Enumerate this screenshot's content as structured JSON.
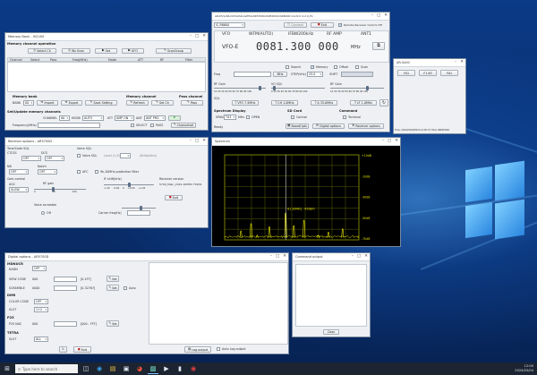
{
  "memory_bank": {
    "title": "Memory Bank - ISCU00",
    "ops_label": "Memory channel operation",
    "buttons": [
      "Select Ch",
      "Ws Scan",
      "Set",
      "UFO",
      "ScanGroup"
    ],
    "columns": [
      "Channel",
      "Select",
      "Pass",
      "Freq(MHz)",
      "Mode",
      "ATT",
      "RF",
      "Filter"
    ],
    "memory_bank_label": "Memory bank",
    "bank_label": "BANK",
    "bank_value": "00",
    "import_label": "Import",
    "export_label": "Export",
    "save_setting_label": "Save Setting",
    "memory_channel_label": "Memory channel",
    "refresh_label": "Refresh",
    "set_ch_label": "Set Ch",
    "pass_channel_label": "Pass channel",
    "pass_label": "Pass",
    "set_update_label": "Set/Update memory channels",
    "channel_label": "CHANNEL",
    "channel_value": "00",
    "mode_label": "MODE",
    "mode_value": "AUTO",
    "att_label": "ATT",
    "att_value": "AMP ON",
    "ant_label": "ANT",
    "ant_value": "ANT PRG",
    "freq_label": "Frequency(MHz)",
    "select_label": "SELECT",
    "pass_chk_label": "PASS",
    "channelset_label": "Channelset"
  },
  "main": {
    "title": "AR-DV1/AR-DV10/AR-ALPHA/AR5700D/AR5001D/AR6000 Control 4.2.0_Ex",
    "mode_badge": "IC-R8600",
    "connect_label": "Connect",
    "exit_label": "Exit",
    "remote_label": "Remote Receiver Control Off",
    "headers": [
      "VFO",
      "WFM(AUTO)",
      "IFBW200kHz",
      "RF AMP",
      "ANT1"
    ],
    "vfo_label": "VFO-E",
    "frequency": "0081.300 000",
    "unit": "MHz",
    "search_label": "Search",
    "memory_label": "Memory",
    "offset_label": "Offset",
    "scan_label": "Scan",
    "freq_label": "Freq",
    "freq_set_label": "MHz",
    "step_label": "STEP(kHz)",
    "step_value": "25.0",
    "shift_label": "SHIFT",
    "rf_gain_label": "RF Gain",
    "vo_sql_label": "VO SQL",
    "rf_gain_scale": "10 20 30 40 50 60 70 80 90 100",
    "rf_gain_scale2": "0 20 30 40 50 60 70 80 90 100",
    "sql_label": "SQL",
    "vfo_buttons": [
      "VFO 7.5MHz",
      "CH 1.0MHz",
      "A 33.0MHz",
      "LF 1.0MHz"
    ],
    "spectrum_display_label": "Spectrum Display",
    "span_label": "SPAN",
    "span_value": "TX3",
    "span_unit": "MHz",
    "open_label": "OPEN",
    "sd_card_label": "SD Card",
    "control_label": "Control",
    "command_label": "Command",
    "terminal_label": "Terminal",
    "ready_label": "Ready",
    "board_label": "BoardOpts",
    "digital_options_label": "Digital options",
    "receiver_options_label": "Receiver options"
  },
  "small_window": {
    "title": "AR-5x00",
    "buttons": [
      "F01",
      "F1 63",
      "F01"
    ],
    "status": "Time: 2024/03/04(ESYS-12:00:??) Total: R8600HAR"
  },
  "receiver_options": {
    "title": "Receiver options - AR5700D",
    "tone_label": "Tone/Code SQL",
    "ctcss_label": "CTCSS",
    "ctcss_value": "OFF",
    "dcs_label": "DCS",
    "dcs_value": "OFF",
    "voice_sql_label": "Voice SQL",
    "voice_sql_chk": "Voice SQL",
    "level_label": "Level (1-9)",
    "attrib_label": "Attrib(dbm)",
    "nb_label": "NB",
    "nb_value": "OFF",
    "notch_label": "Notch",
    "notch_value": "OFF",
    "afc_label": "AFC",
    "lsb_filter_label": "9k-10MHz protection filter",
    "gain_control_label": "Gain control",
    "agc_label": "AGC",
    "agc_value": "SLOW",
    "rf_gain_label": "RF gain",
    "rf_gain_scale": "0 60 100",
    "if_shift_label": "IF shift(kHz)",
    "if_shift_scale": "-1.20 -0.60 0 +0.60 +1.20",
    "receiver_version_label": "Receiver version",
    "receiver_version": "5700_Main_2019 16MHC F0634",
    "exit_label": "Exit",
    "voice_scramble_label": "Voice scramble",
    "vs_value": "Off",
    "carrier_label": "Carrier freq(Hz)"
  },
  "spectrum": {
    "title": "Spectrum",
    "marker_label": "81.30MHz, -45dBm",
    "y_labels": [
      "+10dB",
      "-10dB",
      "-30dB",
      "-50dB",
      "-70dB"
    ],
    "peaks": [
      {
        "freq_mhz": 80.2,
        "level_db": -62
      },
      {
        "freq_mhz": 80.45,
        "level_db": -55
      },
      {
        "freq_mhz": 80.6,
        "level_db": -66
      },
      {
        "freq_mhz": 80.9,
        "level_db": -58
      },
      {
        "freq_mhz": 81.3,
        "level_db": -45
      },
      {
        "freq_mhz": 81.5,
        "level_db": -57
      },
      {
        "freq_mhz": 81.75,
        "level_db": -52
      },
      {
        "freq_mhz": 82.1,
        "level_db": -66
      },
      {
        "freq_mhz": 82.35,
        "level_db": -63
      },
      {
        "freq_mhz": 82.7,
        "level_db": -60
      }
    ]
  },
  "digital_options": {
    "title": "Digital options - AR5700D",
    "mode_label": "MDNUCR",
    "nxdn_label": "NXDN",
    "nxdn_value": "OFF",
    "view_code_label": "VIEW CODE",
    "view_code_value": "000",
    "set_label": "Set",
    "range1": "[0-1FF]",
    "scramble_label": "SCRAMBLE",
    "scramble_value": "0000",
    "range2": "[0-32767]",
    "auto_label": "Auto",
    "dmr_label": "DMR",
    "color_code_label": "COLOR CODE",
    "color_code_value": "OFF",
    "slot_label": "SLOT",
    "slot_value": "1+2",
    "p25_label": "P25",
    "p25_nac_label": "P25 NAC",
    "p25_nac_value": "000",
    "range3": "[000 - FFF]",
    "tetra_label": "TETRA",
    "tetra_slot_label": "SLOT",
    "tetra_slot_value": "ALL",
    "exit_label": "Exit",
    "log_output_label": "Log output",
    "auto_log_label": "Auto Log output"
  },
  "command_output": {
    "title": "Command output",
    "clear_label": "Clear"
  },
  "taskbar": {
    "search_placeholder": "Type here to search",
    "time": "12:00",
    "date": "2024/03/04"
  }
}
